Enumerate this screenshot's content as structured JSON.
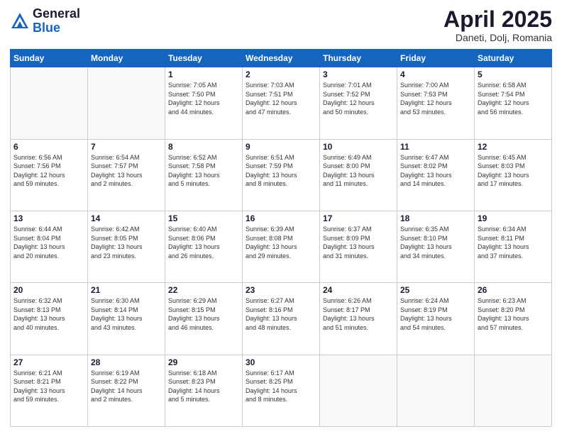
{
  "header": {
    "logo_general": "General",
    "logo_blue": "Blue",
    "month_title": "April 2025",
    "location": "Daneti, Dolj, Romania"
  },
  "weekdays": [
    "Sunday",
    "Monday",
    "Tuesday",
    "Wednesday",
    "Thursday",
    "Friday",
    "Saturday"
  ],
  "weeks": [
    [
      {
        "day": "",
        "info": ""
      },
      {
        "day": "",
        "info": ""
      },
      {
        "day": "1",
        "info": "Sunrise: 7:05 AM\nSunset: 7:50 PM\nDaylight: 12 hours\nand 44 minutes."
      },
      {
        "day": "2",
        "info": "Sunrise: 7:03 AM\nSunset: 7:51 PM\nDaylight: 12 hours\nand 47 minutes."
      },
      {
        "day": "3",
        "info": "Sunrise: 7:01 AM\nSunset: 7:52 PM\nDaylight: 12 hours\nand 50 minutes."
      },
      {
        "day": "4",
        "info": "Sunrise: 7:00 AM\nSunset: 7:53 PM\nDaylight: 12 hours\nand 53 minutes."
      },
      {
        "day": "5",
        "info": "Sunrise: 6:58 AM\nSunset: 7:54 PM\nDaylight: 12 hours\nand 56 minutes."
      }
    ],
    [
      {
        "day": "6",
        "info": "Sunrise: 6:56 AM\nSunset: 7:56 PM\nDaylight: 12 hours\nand 59 minutes."
      },
      {
        "day": "7",
        "info": "Sunrise: 6:54 AM\nSunset: 7:57 PM\nDaylight: 13 hours\nand 2 minutes."
      },
      {
        "day": "8",
        "info": "Sunrise: 6:52 AM\nSunset: 7:58 PM\nDaylight: 13 hours\nand 5 minutes."
      },
      {
        "day": "9",
        "info": "Sunrise: 6:51 AM\nSunset: 7:59 PM\nDaylight: 13 hours\nand 8 minutes."
      },
      {
        "day": "10",
        "info": "Sunrise: 6:49 AM\nSunset: 8:00 PM\nDaylight: 13 hours\nand 11 minutes."
      },
      {
        "day": "11",
        "info": "Sunrise: 6:47 AM\nSunset: 8:02 PM\nDaylight: 13 hours\nand 14 minutes."
      },
      {
        "day": "12",
        "info": "Sunrise: 6:45 AM\nSunset: 8:03 PM\nDaylight: 13 hours\nand 17 minutes."
      }
    ],
    [
      {
        "day": "13",
        "info": "Sunrise: 6:44 AM\nSunset: 8:04 PM\nDaylight: 13 hours\nand 20 minutes."
      },
      {
        "day": "14",
        "info": "Sunrise: 6:42 AM\nSunset: 8:05 PM\nDaylight: 13 hours\nand 23 minutes."
      },
      {
        "day": "15",
        "info": "Sunrise: 6:40 AM\nSunset: 8:06 PM\nDaylight: 13 hours\nand 26 minutes."
      },
      {
        "day": "16",
        "info": "Sunrise: 6:39 AM\nSunset: 8:08 PM\nDaylight: 13 hours\nand 29 minutes."
      },
      {
        "day": "17",
        "info": "Sunrise: 6:37 AM\nSunset: 8:09 PM\nDaylight: 13 hours\nand 31 minutes."
      },
      {
        "day": "18",
        "info": "Sunrise: 6:35 AM\nSunset: 8:10 PM\nDaylight: 13 hours\nand 34 minutes."
      },
      {
        "day": "19",
        "info": "Sunrise: 6:34 AM\nSunset: 8:11 PM\nDaylight: 13 hours\nand 37 minutes."
      }
    ],
    [
      {
        "day": "20",
        "info": "Sunrise: 6:32 AM\nSunset: 8:13 PM\nDaylight: 13 hours\nand 40 minutes."
      },
      {
        "day": "21",
        "info": "Sunrise: 6:30 AM\nSunset: 8:14 PM\nDaylight: 13 hours\nand 43 minutes."
      },
      {
        "day": "22",
        "info": "Sunrise: 6:29 AM\nSunset: 8:15 PM\nDaylight: 13 hours\nand 46 minutes."
      },
      {
        "day": "23",
        "info": "Sunrise: 6:27 AM\nSunset: 8:16 PM\nDaylight: 13 hours\nand 48 minutes."
      },
      {
        "day": "24",
        "info": "Sunrise: 6:26 AM\nSunset: 8:17 PM\nDaylight: 13 hours\nand 51 minutes."
      },
      {
        "day": "25",
        "info": "Sunrise: 6:24 AM\nSunset: 8:19 PM\nDaylight: 13 hours\nand 54 minutes."
      },
      {
        "day": "26",
        "info": "Sunrise: 6:23 AM\nSunset: 8:20 PM\nDaylight: 13 hours\nand 57 minutes."
      }
    ],
    [
      {
        "day": "27",
        "info": "Sunrise: 6:21 AM\nSunset: 8:21 PM\nDaylight: 13 hours\nand 59 minutes."
      },
      {
        "day": "28",
        "info": "Sunrise: 6:19 AM\nSunset: 8:22 PM\nDaylight: 14 hours\nand 2 minutes."
      },
      {
        "day": "29",
        "info": "Sunrise: 6:18 AM\nSunset: 8:23 PM\nDaylight: 14 hours\nand 5 minutes."
      },
      {
        "day": "30",
        "info": "Sunrise: 6:17 AM\nSunset: 8:25 PM\nDaylight: 14 hours\nand 8 minutes."
      },
      {
        "day": "",
        "info": ""
      },
      {
        "day": "",
        "info": ""
      },
      {
        "day": "",
        "info": ""
      }
    ]
  ]
}
